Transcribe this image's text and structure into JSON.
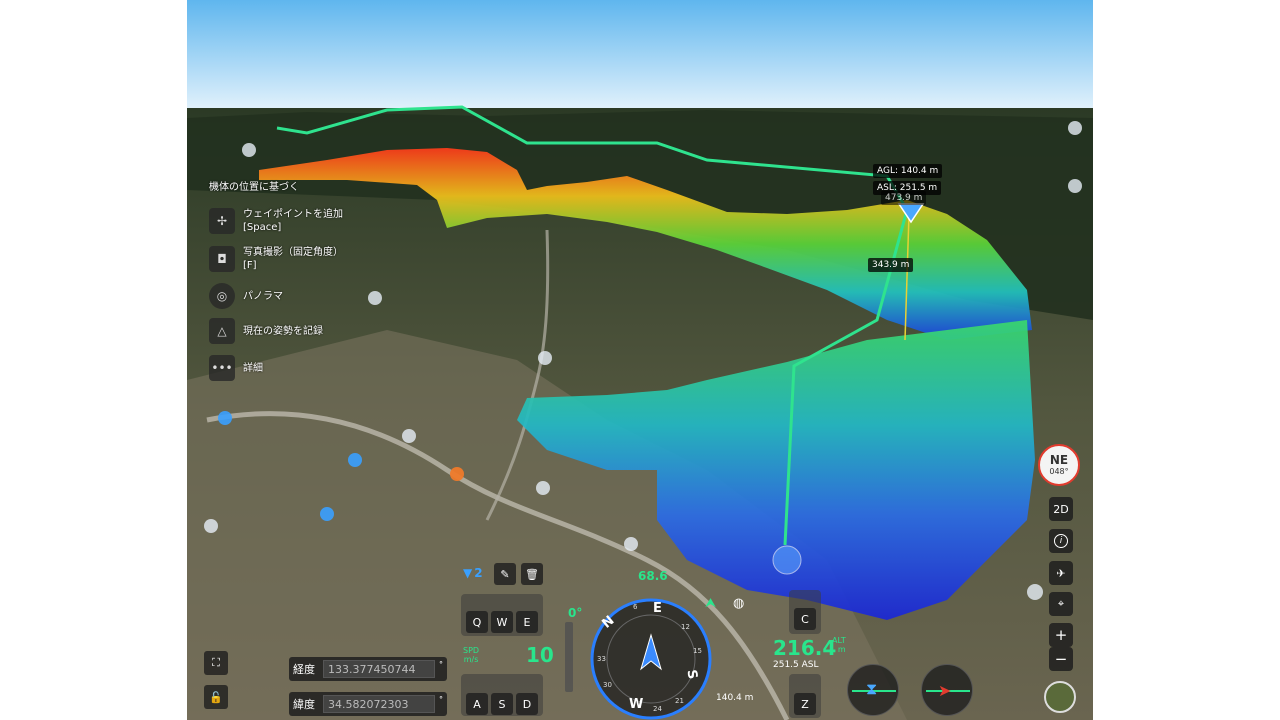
{
  "map_labels": {
    "agl": "AGL: 140.4 m",
    "asl": "ASL: 251.5 m",
    "behind": "473.9 m",
    "segment": "343.9 m"
  },
  "left_menu": {
    "header": "機体の位置に基づく",
    "items": [
      {
        "label": "ウェイポイントを追加",
        "sub": "[Space]",
        "icon": "waypoint-icon"
      },
      {
        "label": "写真撮影（固定角度）",
        "sub": "[F]",
        "icon": "camera-icon"
      },
      {
        "label": "パノラマ",
        "sub": "",
        "icon": "panorama-icon"
      },
      {
        "label": "現在の姿勢を記録",
        "sub": "",
        "icon": "record-pose-icon"
      },
      {
        "label": "詳細",
        "sub": "",
        "icon": "more-icon"
      }
    ]
  },
  "waypoint_tools": {
    "count": "2"
  },
  "keys": {
    "top": [
      "Q",
      "W",
      "E"
    ],
    "bottom": [
      "A",
      "S",
      "D"
    ],
    "up": "C",
    "down": "Z"
  },
  "coords": {
    "lon_label": "経度",
    "lon_value": "133.377450744",
    "lat_label": "緯度",
    "lat_value": "34.582072303",
    "unit": "°"
  },
  "flight": {
    "gimbal_pitch": "0°",
    "speed_value": "10",
    "speed_unit_1": "SPD",
    "speed_unit_2": "m/s",
    "heading_value": "68.6",
    "altitude_value": "216.4",
    "alt_unit_1": "ALT",
    "alt_unit_2": "m",
    "asl_value": "251.5 ASL",
    "distance": "140.4 m"
  },
  "compass": {
    "dir": "NE",
    "deg": "048°",
    "letters": [
      "N",
      "E",
      "S",
      "W"
    ],
    "ticks": [
      "6",
      "12",
      "15",
      "21",
      "24",
      "30",
      "33"
    ]
  },
  "side_buttons": {
    "mode_2d": "2D",
    "info": "i",
    "zoom_in": "+",
    "zoom_out": "−"
  },
  "colors": {
    "route": "#2fe38e",
    "accent_green": "#29e58c",
    "compass_red": "#e23b2e",
    "compass_blue": "#2a7fff"
  }
}
